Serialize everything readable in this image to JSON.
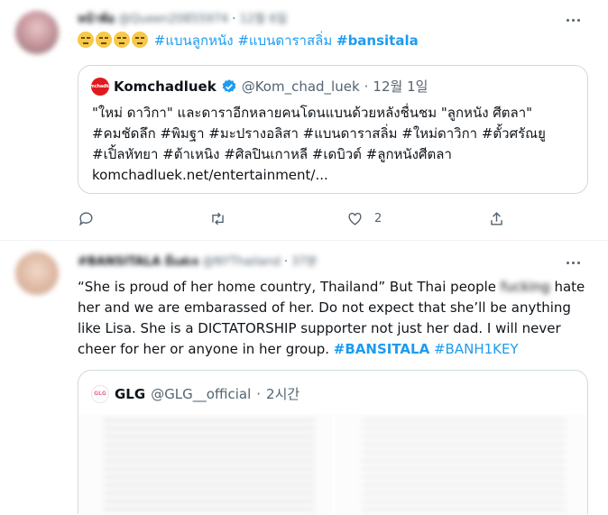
{
  "tweet1": {
    "display_name": "หน้าพ้อ",
    "handle": "@Queen20855974",
    "dot": "·",
    "date": "12월 6일",
    "emoji_name": "expressionless-face",
    "emoji_count": 4,
    "hashtag1": "#แบนลูกหนัง",
    "hashtag2": "#แบนดาราสลิ่ม",
    "hashtag3": "#bansitala",
    "quote": {
      "logo_text": "komchadluek",
      "name": "Komchadluek",
      "handle": "@Kom_chad_luek",
      "dot": "·",
      "date": "12월 1일",
      "line1": "\"ใหม่ ดาวิกา\" และดาราอีกหลายคนโดนแบนด้วยหลังชื่นชม \"ลูกหนัง ศีตลา\"",
      "line2": "#คมชัดลึก #พิมฐา #มะปรางอลิสา #แบนดาราสลิ่ม #ใหม่ดาวิกา #ตั้วศรัณยู",
      "line3": "#เปิ้ลหัทยา #ต้าเหนิง #ศิลปินเกาหลี #เดบิวต์ #ลูกหนังศีตลา",
      "line4": "komchadluek.net/entertainment/..."
    },
    "actions": {
      "like_count": "2"
    }
  },
  "tweet2": {
    "display_name": "#BANSITALA มีแต่เจ",
    "handle": "@NYThailand",
    "dot": "·",
    "date": "37분",
    "line1_a": "“She is proud of her home country, Thailand” But Thai people ",
    "line1_censored": "fucking",
    "line1_b": " hate",
    "line2": "her and we are embarassed of her. Do not expect that she’ll be anything",
    "line3": "like Lisa. She is a DICTATORSHIP supporter not just her dad. I will never",
    "line4_a": "cheer for her or anyone in her group. ",
    "hashtag1": "#BANSITALA",
    "hashtag2": "#BANH1KEY",
    "quote": {
      "logo_text": "GLG",
      "name": "GLG",
      "handle": "@GLG__official",
      "dot": "·",
      "date": "2시간"
    }
  },
  "colors": {
    "link": "#1d9bf0",
    "muted": "#536471",
    "border": "#cfd9de",
    "verified": "#1d9bf0",
    "komchadluek_red": "#e0191f"
  }
}
